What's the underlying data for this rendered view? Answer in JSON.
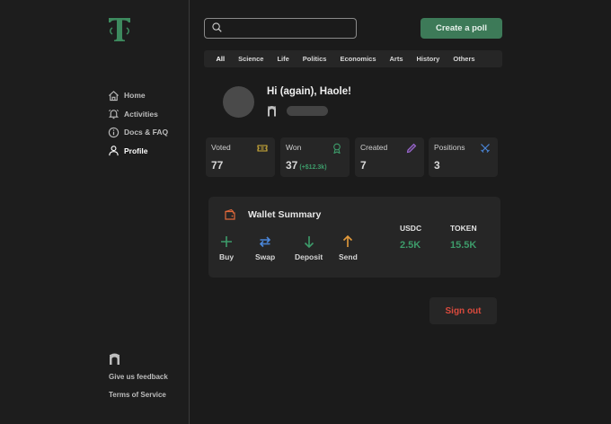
{
  "sidebar": {
    "nav": [
      {
        "label": "Home",
        "icon": "home-icon"
      },
      {
        "label": "Activities",
        "icon": "bell-icon"
      },
      {
        "label": "Docs & FAQ",
        "icon": "info-icon"
      },
      {
        "label": "Profile",
        "icon": "user-icon"
      }
    ],
    "active": "Profile",
    "bottom_links": [
      "Give us feedback",
      "Terms of Service"
    ]
  },
  "header": {
    "search_placeholder": "",
    "create_label": "Create a poll"
  },
  "categories": [
    "All",
    "Science",
    "Life",
    "Politics",
    "Economics",
    "Arts",
    "History",
    "Others"
  ],
  "profile": {
    "greeting": "Hi (again), Haole!"
  },
  "stats": [
    {
      "label": "Voted",
      "value": "77",
      "sub": "",
      "icon": "ticket-icon",
      "color": "#d4b13a"
    },
    {
      "label": "Won",
      "value": "37",
      "sub": "(+$12.3k)",
      "icon": "award-icon",
      "color": "#3d9b6a"
    },
    {
      "label": "Created",
      "value": "7",
      "sub": "",
      "icon": "pencil-icon",
      "color": "#a06ad8"
    },
    {
      "label": "Positions",
      "value": "3",
      "sub": "",
      "icon": "swords-icon",
      "color": "#4a86d8"
    }
  ],
  "wallet": {
    "title": "Wallet Summary",
    "actions": [
      {
        "label": "Buy",
        "icon": "plus-icon",
        "color": "#3d9b6a"
      },
      {
        "label": "Swap",
        "icon": "swap-icon",
        "color": "#4a86d8"
      },
      {
        "label": "Deposit",
        "icon": "arrow-down-icon",
        "color": "#3d9b6a"
      },
      {
        "label": "Send",
        "icon": "arrow-up-icon",
        "color": "#e39a3b"
      }
    ],
    "balances": [
      {
        "label": "USDC",
        "value": "2.5K"
      },
      {
        "label": "TOKEN",
        "value": "15.5K"
      }
    ]
  },
  "signout_label": "Sign out",
  "colors": {
    "accent": "#3d7a58",
    "green": "#3d9b6a",
    "danger": "#d94a3d",
    "card": "#262626",
    "background": "#1b1b1b"
  }
}
